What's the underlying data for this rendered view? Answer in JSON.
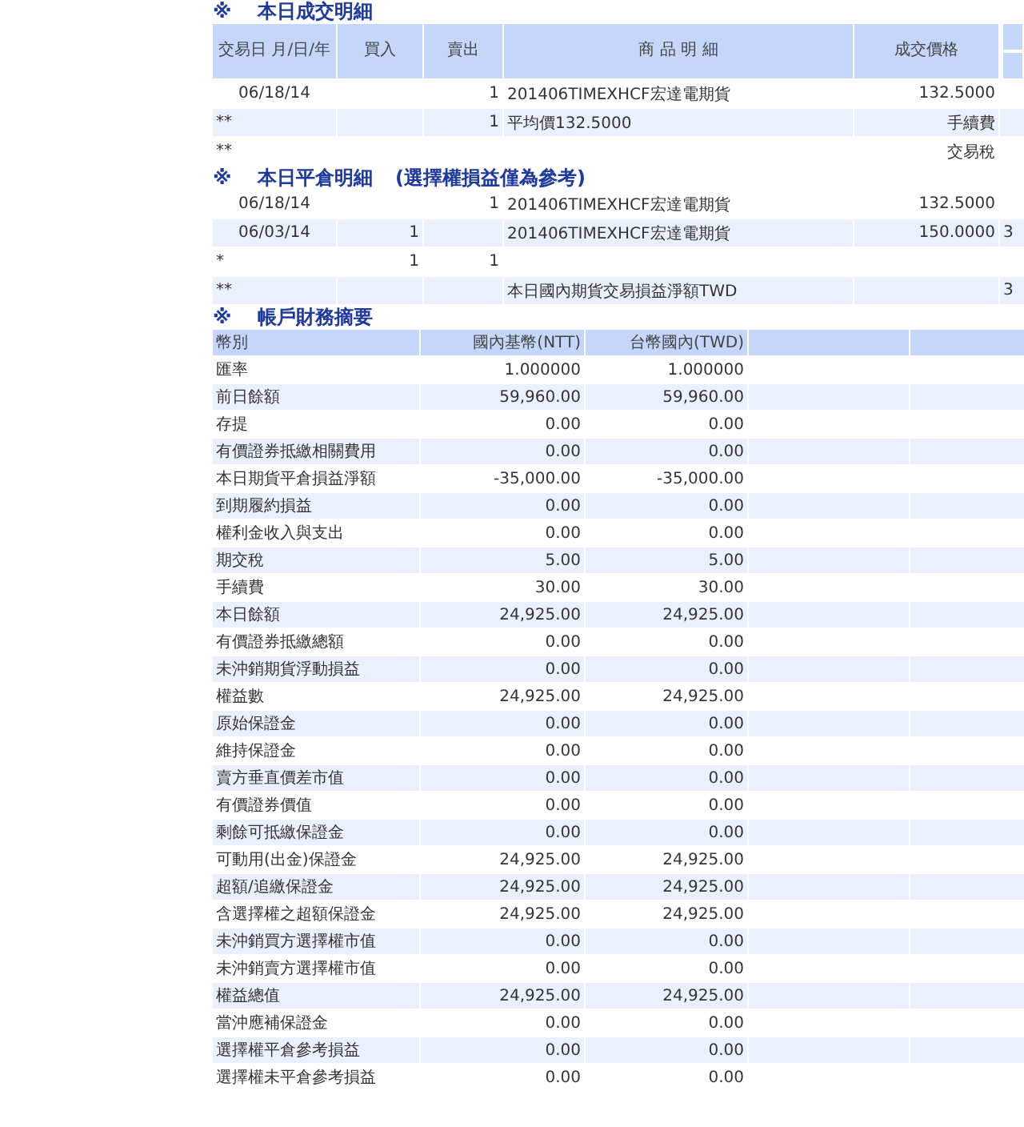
{
  "trades": {
    "title_mark": "※",
    "title": "本日成交明細",
    "columns": [
      "交易日\n月/日/年",
      "買入",
      "賣出",
      "商 品 明 細",
      "成交價格"
    ],
    "rows": [
      {
        "kind": "detail",
        "cells": [
          "06/18/14",
          "",
          "1",
          "201406TIMEXHCF宏達電期貨",
          "132.5000",
          ""
        ]
      },
      {
        "kind": "subtotal",
        "cells": [
          "**",
          "",
          "1",
          "平均價132.5000",
          "手續費",
          ""
        ]
      },
      {
        "kind": "subtotal",
        "cells": [
          "**",
          "",
          "",
          "",
          "交易稅",
          ""
        ]
      }
    ]
  },
  "closing": {
    "title_mark": "※",
    "title": "本日平倉明細",
    "note": "(選擇權損益僅為參考)",
    "rows": [
      {
        "kind": "detail",
        "cells": [
          "06/18/14",
          "",
          "1",
          "201406TIMEXHCF宏達電期貨",
          "132.5000",
          ""
        ]
      },
      {
        "kind": "detail",
        "cells": [
          "06/03/14",
          "1",
          "",
          "201406TIMEXHCF宏達電期貨",
          "150.0000",
          "3"
        ]
      },
      {
        "kind": "subtotal",
        "cells": [
          "*",
          "1",
          "1",
          "",
          "",
          ""
        ]
      },
      {
        "kind": "subtotal",
        "cells": [
          "**",
          "",
          "",
          "本日國內期貨交易損益淨額TWD",
          "",
          "3"
        ]
      }
    ]
  },
  "summary": {
    "title_mark": "※",
    "title": "帳戶財務摘要",
    "columns": [
      "幣別",
      "國內基幣(NTT)",
      "台幣國內(TWD)"
    ],
    "rows": [
      {
        "label": "匯率",
        "ntt": "1.000000",
        "twd": "1.000000"
      },
      {
        "label": "前日餘額",
        "ntt": "59,960.00",
        "twd": "59,960.00"
      },
      {
        "label": "存提",
        "ntt": "0.00",
        "twd": "0.00"
      },
      {
        "label": "有價證券抵繳相關費用",
        "ntt": "0.00",
        "twd": "0.00"
      },
      {
        "label": "本日期貨平倉損益淨額",
        "ntt": "-35,000.00",
        "twd": "-35,000.00"
      },
      {
        "label": "到期履約損益",
        "ntt": "0.00",
        "twd": "0.00"
      },
      {
        "label": "權利金收入與支出",
        "ntt": "0.00",
        "twd": "0.00"
      },
      {
        "label": "期交稅",
        "ntt": "5.00",
        "twd": "5.00"
      },
      {
        "label": "手續費",
        "ntt": "30.00",
        "twd": "30.00"
      },
      {
        "label": "本日餘額",
        "ntt": "24,925.00",
        "twd": "24,925.00"
      },
      {
        "label": "有價證券抵繳總額",
        "ntt": "0.00",
        "twd": "0.00"
      },
      {
        "label": "未沖銷期貨浮動損益",
        "ntt": "0.00",
        "twd": "0.00"
      },
      {
        "label": "權益數",
        "ntt": "24,925.00",
        "twd": "24,925.00"
      },
      {
        "label": "原始保證金",
        "ntt": "0.00",
        "twd": "0.00"
      },
      {
        "label": "維持保證金",
        "ntt": "0.00",
        "twd": "0.00"
      },
      {
        "label": "賣方垂直價差市值",
        "ntt": "0.00",
        "twd": "0.00"
      },
      {
        "label": "有價證券價值",
        "ntt": "0.00",
        "twd": "0.00"
      },
      {
        "label": "剩餘可抵繳保證金",
        "ntt": "0.00",
        "twd": "0.00"
      },
      {
        "label": "可動用(出金)保證金",
        "ntt": "24,925.00",
        "twd": "24,925.00"
      },
      {
        "label": "超額/追繳保證金",
        "ntt": "24,925.00",
        "twd": "24,925.00"
      },
      {
        "label": "含選擇權之超額保證金",
        "ntt": "24,925.00",
        "twd": "24,925.00"
      },
      {
        "label": "未沖銷買方選擇權市值",
        "ntt": "0.00",
        "twd": "0.00"
      },
      {
        "label": "未沖銷賣方選擇權市值",
        "ntt": "0.00",
        "twd": "0.00"
      },
      {
        "label": "權益總值",
        "ntt": "24,925.00",
        "twd": "24,925.00"
      },
      {
        "label": "當沖應補保證金",
        "ntt": "0.00",
        "twd": "0.00"
      },
      {
        "label": "選擇權平倉參考損益",
        "ntt": "0.00",
        "twd": "0.00"
      },
      {
        "label": "選擇權未平倉參考損益",
        "ntt": "0.00",
        "twd": "0.00"
      }
    ]
  }
}
